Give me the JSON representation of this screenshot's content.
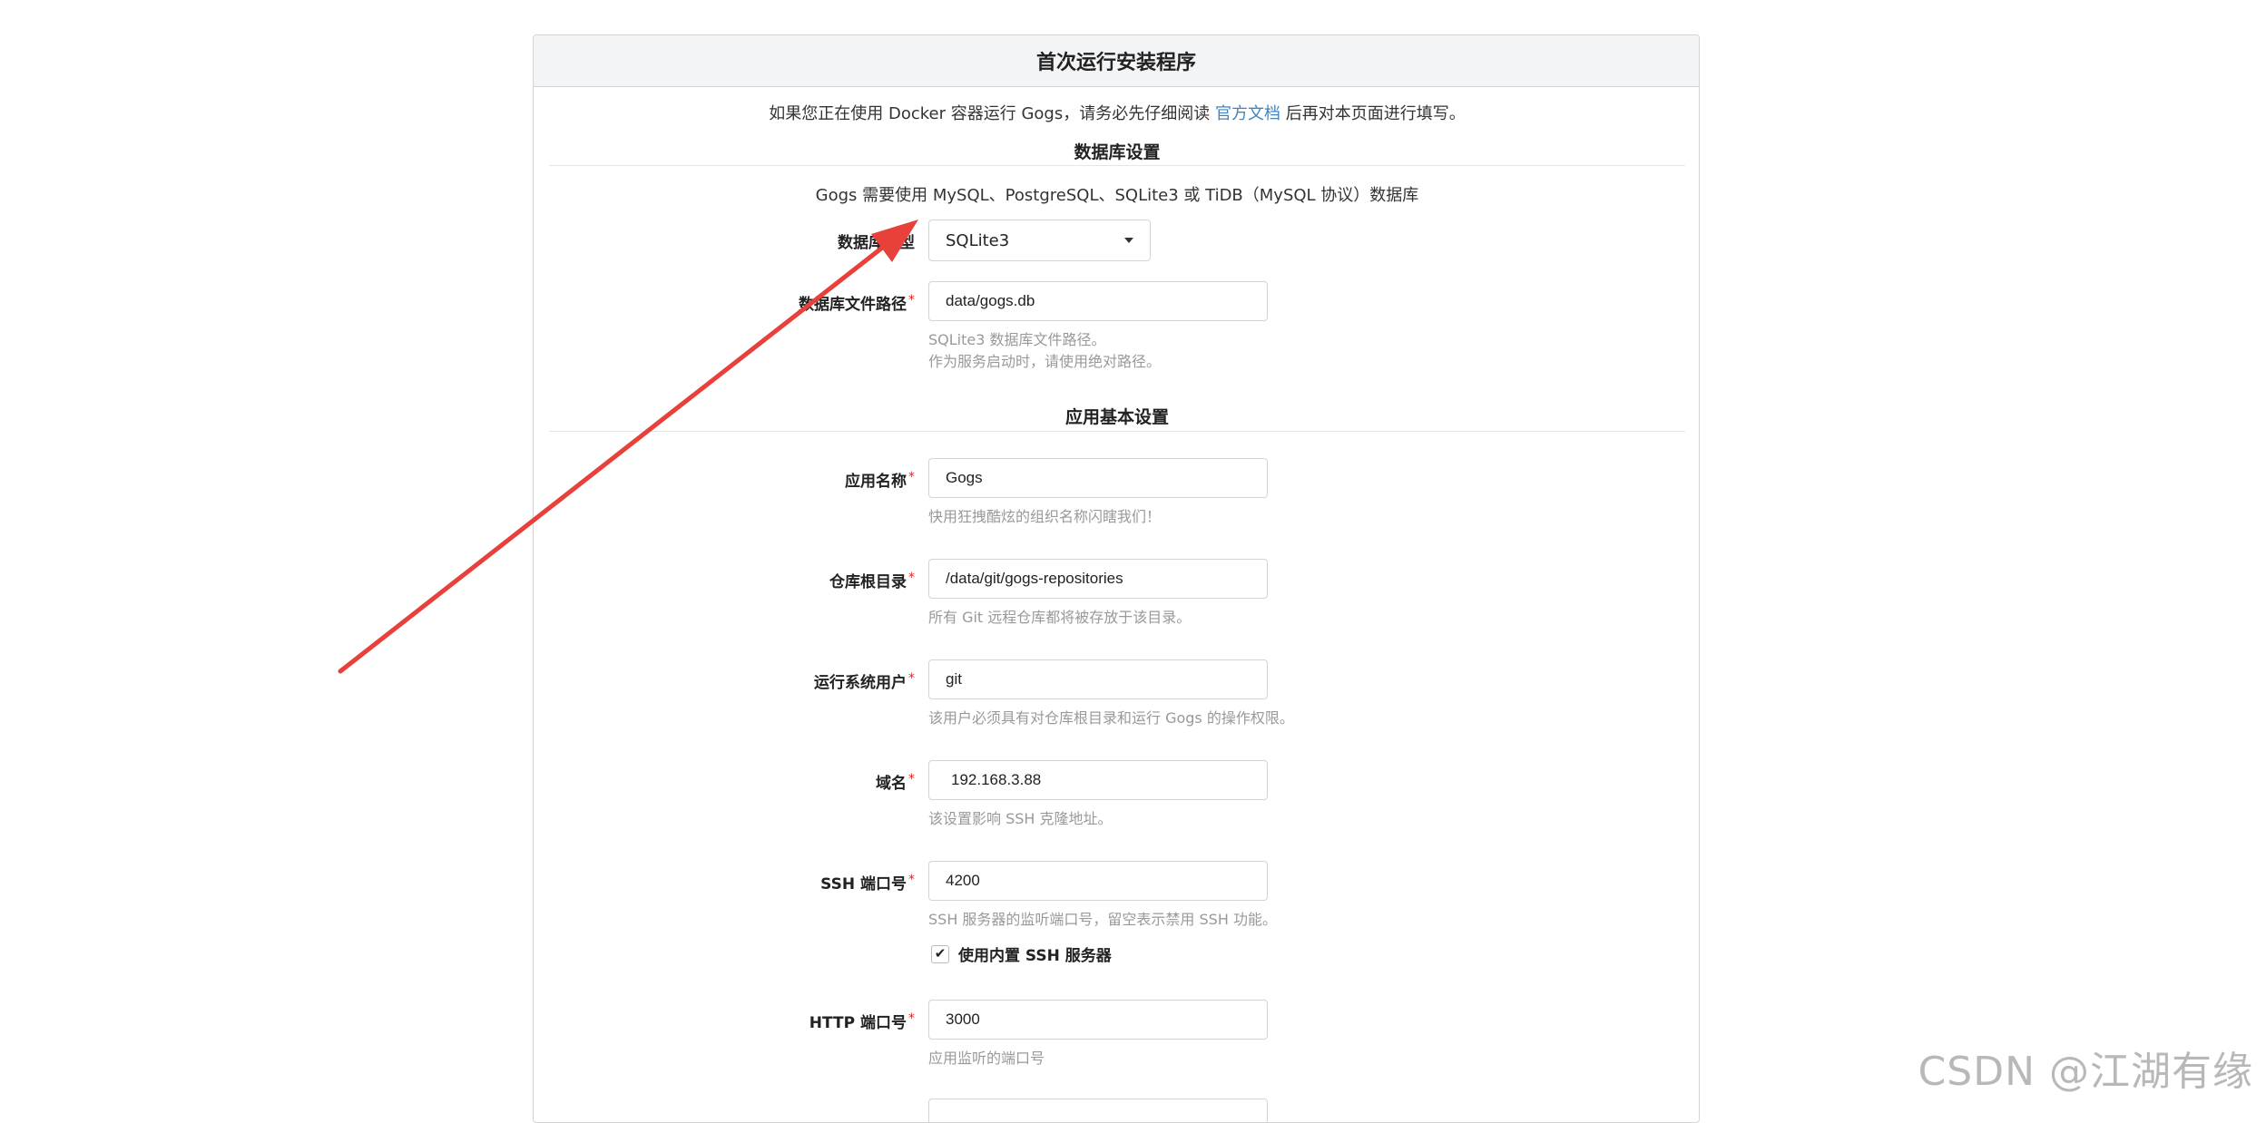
{
  "header": {
    "title": "首次运行安装程序"
  },
  "notice": {
    "before": "如果您正在使用 Docker 容器运行 Gogs，请务必先仔细阅读 ",
    "link": "官方文档",
    "after": " 后再对本页面进行填写。"
  },
  "database": {
    "section_title": "数据库设置",
    "description": "Gogs 需要使用 MySQL、PostgreSQL、SQLite3 或 TiDB（MySQL 协议）数据库",
    "type_label": "数据库类型",
    "type_value": "SQLite3",
    "path_label": "数据库文件路径",
    "path_value": "data/gogs.db",
    "path_help_1": "SQLite3 数据库文件路径。",
    "path_help_2": "作为服务启动时，请使用绝对路径。"
  },
  "app": {
    "section_title": "应用基本设置",
    "name_label": "应用名称",
    "name_value": "Gogs",
    "name_help": "快用狂拽酷炫的组织名称闪瞎我们！",
    "repo_label": "仓库根目录",
    "repo_value": "/data/git/gogs-repositories",
    "repo_help": "所有 Git 远程仓库都将被存放于该目录。",
    "user_label": "运行系统用户",
    "user_value": "git",
    "user_help": "该用户必须具有对仓库根目录和运行 Gogs 的操作权限。",
    "domain_label": "域名",
    "domain_value": "192.168.3.88",
    "domain_help": "该设置影响 SSH 克隆地址。",
    "ssh_label": "SSH 端口号",
    "ssh_value": "4200",
    "ssh_help": "SSH 服务器的监听端口号，留空表示禁用 SSH 功能。",
    "builtin_ssh_label": "使用内置 SSH 服务器",
    "builtin_ssh_checked": true,
    "http_label": "HTTP 端口号",
    "http_value": "3000",
    "http_help": "应用监听的端口号"
  },
  "required_mark": "*",
  "watermark": "CSDN @江湖有缘",
  "colors": {
    "link": "#4183c4",
    "required": "#db2828",
    "arrow": "#e8403a"
  }
}
